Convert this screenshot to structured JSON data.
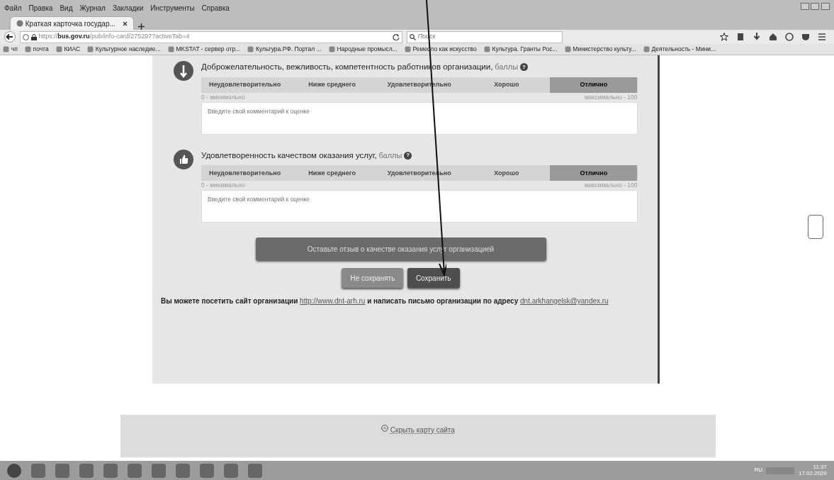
{
  "menu": [
    "Файл",
    "Правка",
    "Вид",
    "Журнал",
    "Закладки",
    "Инструменты",
    "Справка"
  ],
  "tabs": [
    {
      "title": "Краткая карточка государ...",
      "selected": true
    }
  ],
  "address": {
    "url_host": "bus.gov.ru",
    "url_prefix": "https://",
    "url_path": "/pub/info-card/275297?activeTab=4",
    "search_placeholder": "Поиск"
  },
  "bookmarks": [
    "чп",
    "почта",
    "КИАС",
    "Культурное наследие...",
    "MKSTAT - сервер отр...",
    "Культура.РФ. Портал ...",
    "Народные промысл...",
    "Ремесло как искусство",
    "Культура. Гранты Рос...",
    "Министерство культу...",
    "Деятельность - Мини..."
  ],
  "ratings": [
    {
      "title": "Доброжелательность, вежливость, компетентность работников организации,",
      "unit": "баллы",
      "help": "?",
      "min_label": "0 - минимально",
      "max_label": "максимально - 100",
      "comment_placeholder": "Введите свой комментарий к оценке",
      "options": [
        {
          "label": "Неудовлетворительно",
          "selected": false
        },
        {
          "label": "Ниже среднего",
          "selected": false
        },
        {
          "label": "Удовлетворительно",
          "selected": false
        },
        {
          "label": "Хорошо",
          "selected": false
        },
        {
          "label": "Отлично",
          "selected": true
        }
      ]
    },
    {
      "title": "Удовлетворенность качеством оказания услуг,",
      "unit": "баллы",
      "help": "?",
      "min_label": "0 - минимально",
      "max_label": "максимально - 100",
      "comment_placeholder": "Введите свой комментарий к оценке",
      "options": [
        {
          "label": "Неудовлетворительно",
          "selected": false
        },
        {
          "label": "Ниже среднего",
          "selected": false
        },
        {
          "label": "Удовлетворительно",
          "selected": false
        },
        {
          "label": "Хорошо",
          "selected": false
        },
        {
          "label": "Отлично",
          "selected": true
        }
      ]
    }
  ],
  "feedback_button": "Оставьте отзыв о качестве оказания услуг организацией",
  "buttons": [
    {
      "label": "Не сохранять",
      "kind": "cancel"
    },
    {
      "label": "Сохранить",
      "kind": "save"
    }
  ],
  "contact": {
    "text_1": "Вы можете посетить сайт организации",
    "link_1": "http://www.dnt-arh.ru",
    "text_2": "и написать письмо организации по адресу",
    "link_2": "dnt.arkhangelsk@yandex.ru"
  },
  "footer_link": "Скрыть карту сайта",
  "taskbar": {
    "lang": "RU",
    "time": "11:37",
    "date": "17.02.2020"
  }
}
